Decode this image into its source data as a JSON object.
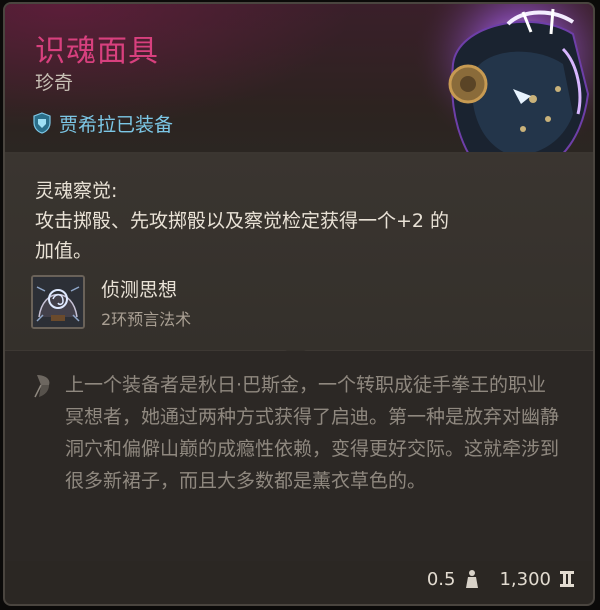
{
  "item": {
    "name": "识魂面具",
    "rarity": "珍奇",
    "equipped_by": "贾希拉已装备"
  },
  "ability": {
    "title": "灵魂察觉:",
    "description": "攻击掷骰、先攻掷骰以及察觉检定获得一个+2 的加值。"
  },
  "spell": {
    "name": "侦测思想",
    "level": "2环预言法术"
  },
  "lore": {
    "text": "上一个装备者是秋日·巴斯金，一个转职成徒手拳王的职业冥想者，她通过两种方式获得了启迪。第一种是放弃对幽静洞穴和偏僻山巅的成瘾性依赖，变得更好交际。这就牵涉到很多新裙子，而且大多数都是薰衣草色的。"
  },
  "footer": {
    "weight": "0.5",
    "value": "1,300"
  },
  "colors": {
    "rarity_name": "#d8407e",
    "equipped": "#7cc7e6",
    "body_text": "#e9e2d6",
    "lore_text": "#8f887f"
  },
  "icons": {
    "equipped": "helmet-shield-icon",
    "spell": "detect-thoughts-icon",
    "lore": "quill-icon",
    "weight": "weight-icon",
    "gold": "gold-coin-icon",
    "item_art": "soul-mask-art"
  }
}
